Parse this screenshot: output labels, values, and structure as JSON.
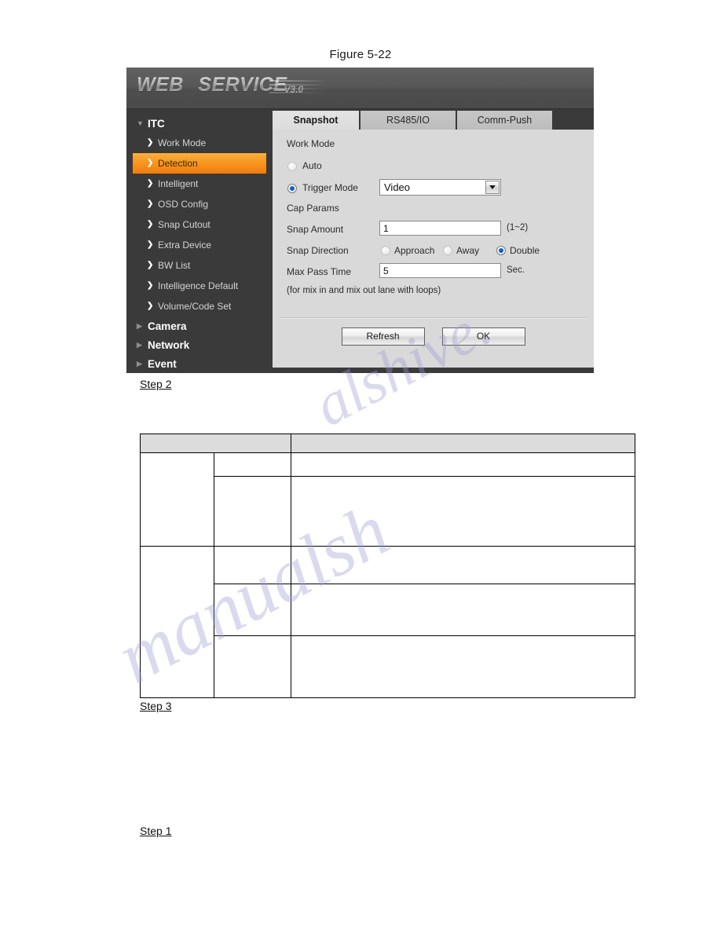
{
  "figure": {
    "caption": "Figure 5-22"
  },
  "webui": {
    "logo": {
      "word1": "WEB",
      "word2": "SERVICE",
      "version": "V3.0"
    },
    "sidebar": {
      "groups": [
        {
          "label": "ITC",
          "expanded": true,
          "caret": "▼"
        },
        {
          "label": "Camera",
          "expanded": false,
          "caret": "▶"
        },
        {
          "label": "Network",
          "expanded": false,
          "caret": "▶"
        },
        {
          "label": "Event",
          "expanded": false,
          "caret": "▶"
        }
      ],
      "items": [
        {
          "label": "Work Mode",
          "active": false
        },
        {
          "label": "Detection",
          "active": true
        },
        {
          "label": "Intelligent",
          "active": false
        },
        {
          "label": "OSD Config",
          "active": false
        },
        {
          "label": "Snap Cutout",
          "active": false
        },
        {
          "label": "Extra Device",
          "active": false
        },
        {
          "label": "BW List",
          "active": false
        },
        {
          "label": "Intelligence Default",
          "active": false
        },
        {
          "label": "Volume/Code Set",
          "active": false
        }
      ],
      "chevron": "❯",
      "highlight_color": "#f7941e"
    },
    "tabs": [
      {
        "label": "Snapshot",
        "active": true
      },
      {
        "label": "RS485/IO",
        "active": false
      },
      {
        "label": "Comm-Push",
        "active": false
      }
    ],
    "form": {
      "work_mode_title": "Work Mode",
      "auto_label": "Auto",
      "auto_selected": false,
      "trigger_mode_label": "Trigger Mode",
      "trigger_mode_selected": true,
      "trigger_mode_value": "Video",
      "cap_params_title": "Cap Params",
      "snap_amount_label": "Snap Amount",
      "snap_amount_value": "1",
      "snap_amount_range": "(1~2)",
      "snap_direction_label": "Snap Direction",
      "snap_direction_options": [
        {
          "label": "Approach",
          "selected": false
        },
        {
          "label": "Away",
          "selected": false
        },
        {
          "label": "Double",
          "selected": true
        }
      ],
      "max_pass_time_label": "Max Pass Time",
      "max_pass_time_value": "5",
      "max_pass_time_unit": "Sec.",
      "note": "(for mix in and mix out lane with loops)"
    },
    "buttons": {
      "refresh": "Refresh",
      "ok": "OK"
    }
  },
  "document": {
    "step2": "Step 2",
    "step3": "Step 3",
    "step1": "Step 1"
  },
  "table": {
    "header": [
      "",
      ""
    ],
    "rows": [
      {
        "cells": [
          "",
          "",
          ""
        ]
      },
      {
        "cells": [
          "",
          "",
          ""
        ]
      },
      {
        "cells": [
          "",
          "",
          ""
        ]
      },
      {
        "cells": [
          "",
          "",
          ""
        ]
      },
      {
        "cells": [
          "",
          "",
          ""
        ]
      }
    ]
  },
  "watermark": {
    "line1": "alshive.",
    "line2": "manualsh"
  }
}
